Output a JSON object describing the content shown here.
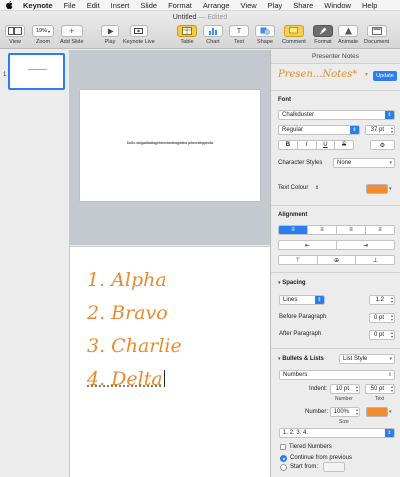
{
  "menubar": {
    "app_name": "Keynote",
    "items": [
      "File",
      "Edit",
      "Insert",
      "Slide",
      "Format",
      "Arrange",
      "View",
      "Play",
      "Share",
      "Window",
      "Help"
    ]
  },
  "window": {
    "title": "Untitled",
    "status": "— Edited"
  },
  "toolbar": {
    "view_label": "View",
    "zoom_value": "19%",
    "zoom_label": "Zoom",
    "add_slide_label": "Add Slide",
    "play_label": "Play",
    "keynote_live_label": "Keynote Live",
    "table_label": "Table",
    "chart_label": "Chart",
    "text_label": "Text",
    "shape_label": "Shape",
    "comment_label": "Comment",
    "format_label": "Format",
    "animate_label": "Animate",
    "document_label": "Document"
  },
  "navigator": {
    "slide_number": "1"
  },
  "slide": {
    "text": "Dollo dolgadladlaghldemlasthagdaha pllovedhpphdla"
  },
  "notes": {
    "items": [
      "1. Alpha",
      "2. Bravo",
      "3. Charlie",
      "4. Delta"
    ],
    "color": "#e98a2d"
  },
  "inspector": {
    "tab": "Presenter Notes",
    "style_name": "Presen...Notes*",
    "update_label": "Update",
    "font": {
      "section_label": "Font",
      "family": "Chalkduster",
      "typeface": "Regular",
      "size": "37 pt",
      "bold": "B",
      "italic": "I",
      "underline": "U",
      "character_styles_label": "Character Styles",
      "character_styles_value": "None",
      "text_colour_label": "Text Colour",
      "text_colour": "#f28b2e"
    },
    "alignment": {
      "section_label": "Alignment"
    },
    "spacing": {
      "section_label": "Spacing",
      "mode": "Lines",
      "value": "1.2",
      "before_label": "Before Paragraph",
      "before_value": "0 pt",
      "after_label": "After Paragraph",
      "after_value": "0 pt"
    },
    "bullets": {
      "section_label": "Bullets & Lists",
      "list_style": "List Style",
      "type": "Numbers",
      "indent_label": "Indent:",
      "number_indent": "10 pt",
      "text_indent": "50 pt",
      "number_caption": "Number",
      "text_caption": "Text",
      "number_label": "Number:",
      "size_value": "100%",
      "size_caption": "Size",
      "number_color": "#f28b2e",
      "format": "1. 2. 3. 4.",
      "tiered_label": "Tiered Numbers",
      "continue_label": "Continue from previous",
      "start_label": "Start from:"
    }
  }
}
